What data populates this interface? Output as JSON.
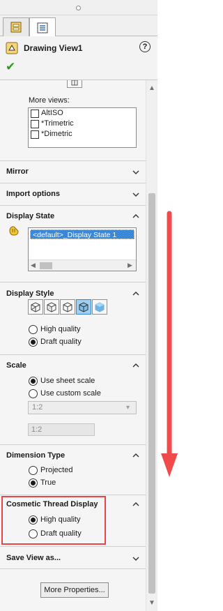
{
  "window": {
    "title": "Drawing View1"
  },
  "icons": {
    "help": "?",
    "ok": "✔"
  },
  "more_views": {
    "label": "More views:",
    "items": [
      {
        "label": "AltISO",
        "checked": false
      },
      {
        "label": "*Trimetric",
        "checked": false
      },
      {
        "label": "*Dimetric",
        "checked": false
      }
    ]
  },
  "sections": {
    "mirror": "Mirror",
    "import_options": "Import options",
    "display_state": "Display State",
    "display_style": "Display Style",
    "scale": "Scale",
    "dimension_type": "Dimension Type",
    "cosmetic_thread": "Cosmetic Thread Display",
    "save_view": "Save View as..."
  },
  "display_state": {
    "selected": "<default>_Display State 1"
  },
  "display_style": {
    "options": [
      "High quality",
      "Draft quality"
    ],
    "selected_index": 1
  },
  "scale": {
    "options": [
      "Use sheet scale",
      "Use custom scale"
    ],
    "selected_index": 0,
    "dropdown_value": "1:2",
    "text_value": "1:2"
  },
  "dimension_type": {
    "options": [
      "Projected",
      "True"
    ],
    "selected_index": 1
  },
  "cosmetic_thread": {
    "options": [
      "High quality",
      "Draft quality"
    ],
    "selected_index": 0
  },
  "more_properties_label": "More Properties...",
  "colors": {
    "accent": "#3b87d8",
    "highlight": "#e84646",
    "arrow": "#f04a4a"
  }
}
